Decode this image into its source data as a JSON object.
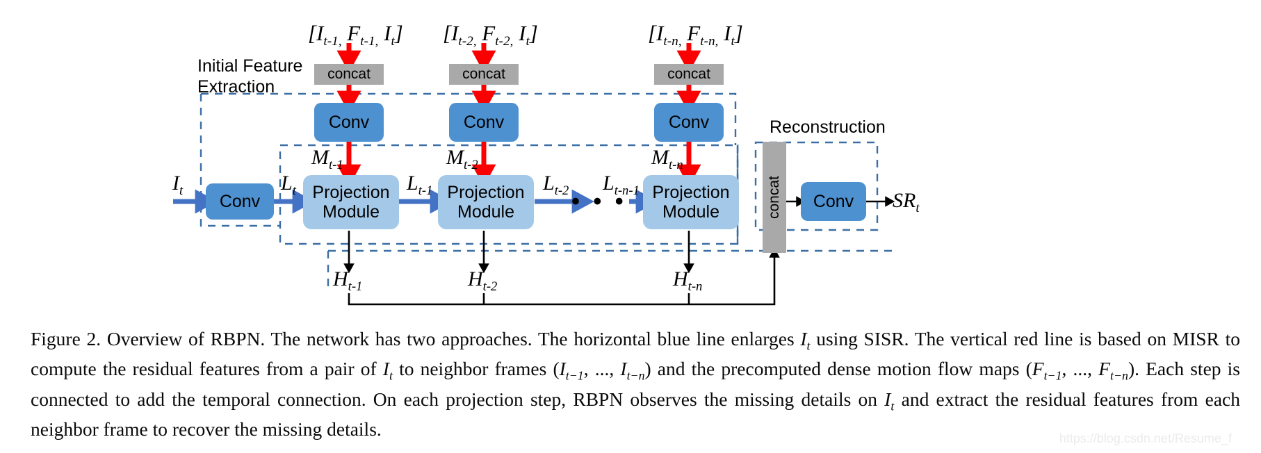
{
  "figure": {
    "groups": [
      {
        "id": "initial-feature-extraction",
        "label": "Initial Feature\nExtraction"
      },
      {
        "id": "reconstruction",
        "label": "Reconstruction"
      }
    ],
    "inputs": [
      {
        "id": "input-1",
        "base_left": "[I",
        "sub_left": "t-1,",
        "base_mid": "F",
        "sub_mid": "t-1,",
        "base_right": "I",
        "sub_right": "t",
        "close": "]"
      },
      {
        "id": "input-2",
        "base_left": "[I",
        "sub_left": "t-2,",
        "base_mid": "F",
        "sub_mid": "t-2,",
        "base_right": "I",
        "sub_right": "t",
        "close": "]"
      },
      {
        "id": "input-n",
        "base_left": "[I",
        "sub_left": "t-n,",
        "base_mid": "F",
        "sub_mid": "t-n,",
        "base_right": "I",
        "sub_right": "t",
        "close": "]"
      }
    ],
    "concat_boxes": [
      {
        "id": "concat-1",
        "label": "concat"
      },
      {
        "id": "concat-2",
        "label": "concat"
      },
      {
        "id": "concat-n",
        "label": "concat"
      }
    ],
    "conv_boxes": [
      {
        "id": "conv-input",
        "label": "Conv"
      },
      {
        "id": "conv-branch-1",
        "label": "Conv"
      },
      {
        "id": "conv-branch-2",
        "label": "Conv"
      },
      {
        "id": "conv-branch-n",
        "label": "Conv"
      },
      {
        "id": "conv-reconstruction",
        "label": "Conv"
      }
    ],
    "projection_modules": [
      {
        "id": "projection-1",
        "line1": "Projection",
        "line2": "Module"
      },
      {
        "id": "projection-2",
        "line1": "Projection",
        "line2": "Module"
      },
      {
        "id": "projection-n",
        "line1": "Projection",
        "line2": "Module"
      }
    ],
    "reconstruction_concat": {
      "id": "concat-reconstruction",
      "label": "concat"
    },
    "signals": {
      "input_frame": {
        "base": "I",
        "sub": "t"
      },
      "output": {
        "base": "SR",
        "sub": "t"
      },
      "lt": {
        "base": "L",
        "sub": "t"
      },
      "l_t_1": {
        "base": "L",
        "sub": "t-1"
      },
      "l_t_2": {
        "base": "L",
        "sub": "t-2"
      },
      "l_t_n_1": {
        "base": "L",
        "sub": "t-n-1"
      },
      "m_t_1": {
        "base": "M",
        "sub": "t-1"
      },
      "m_t_2": {
        "base": "M",
        "sub": "t-2"
      },
      "m_t_n": {
        "base": "M",
        "sub": "t-n"
      },
      "h_t_1": {
        "base": "H",
        "sub": "t-1"
      },
      "h_t_2": {
        "base": "H",
        "sub": "t-2"
      },
      "h_t_n": {
        "base": "H",
        "sub": "t-n"
      }
    },
    "ellipsis": "• • •",
    "colors": {
      "conv_blue": "#4e91d0",
      "projection_blue": "#a4c9e8",
      "concat_gray": "#a9a9a9",
      "arrow_blue": "#4472c4",
      "arrow_red": "#fb0000",
      "dashed_border": "#3b6ea5",
      "arrow_black": "#000000"
    }
  },
  "caption": {
    "p1": "Figure 2. Overview of RBPN. The network has two approaches.  The horizontal blue line enlarges ",
    "m1_base": "I",
    "m1_sub": "t",
    "p2": " using SISR. The vertical red line is based on MISR to compute the residual features from a pair of ",
    "m2_base": "I",
    "m2_sub": "t",
    "p3": " to neighbor frames (",
    "m3_base": "I",
    "m3_sub": "t−1",
    "p4": ", ..., ",
    "m4_base": "I",
    "m4_sub": "t−n",
    "p5": ") and the precomputed dense motion flow maps (",
    "m5_base": "F",
    "m5_sub": "t−1",
    "p6": ", ..., ",
    "m6_base": "F",
    "m6_sub": "t−n",
    "p7": "). Each step is connected to add the temporal connection. On each projection step, RBPN observes the missing details on ",
    "m7_base": "I",
    "m7_sub": "t",
    "p8": " and extract the residual features from each neighbor frame to recover the missing details."
  },
  "watermark": "https://blog.csdn.net/Resume_f"
}
